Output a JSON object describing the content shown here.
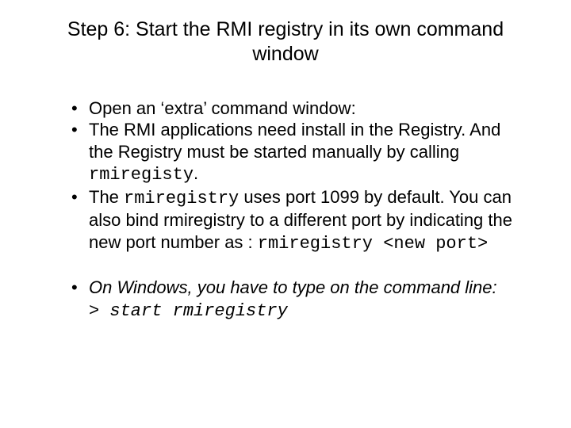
{
  "title": "Step 6: Start the RMI registry in its own command window",
  "bullets": {
    "b1_text": "Open an ‘extra’ command window:",
    "b2_a": "The RMI applications need install in the Registry. And the Registry must be started manually by calling ",
    "b2_code": "rmiregisty",
    "b2_b": ".",
    "b3_a": "The ",
    "b3_code1": "rmiregistry",
    "b3_b": " uses port 1099 by default. You can also bind rmiregistry to a different port by indicating the new port number as : ",
    "b3_code2": "rmiregistry <new port>",
    "b4_text": "On Windows, you have to type on the command line:",
    "b4_cmd": "> start rmiregistry"
  }
}
